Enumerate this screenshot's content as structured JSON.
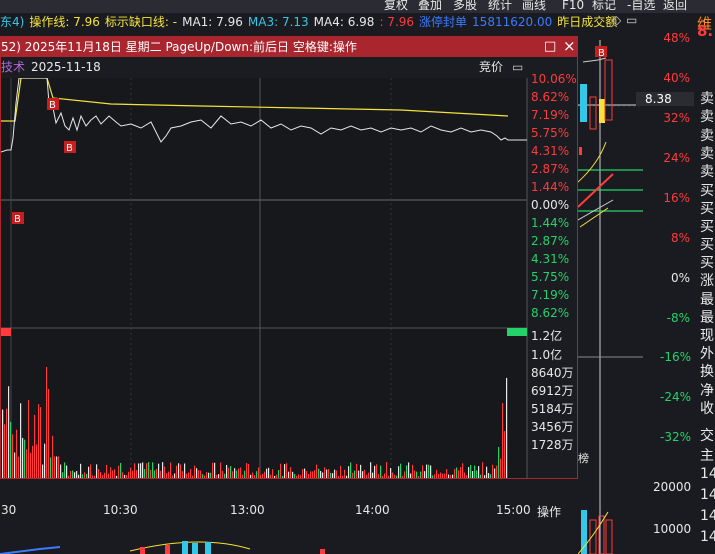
{
  "toolbar": {
    "buttons": [
      "复权",
      "叠加",
      "多股",
      "统计",
      "画线",
      "F10",
      "标记",
      "-自选",
      "返回"
    ],
    "accent_label": "维",
    "price_fragment": "8."
  },
  "indicator_line": {
    "prefix": "东4)",
    "op_line": "操作线: 7.96",
    "gap_line": "标示缺口线: -",
    "ma1": "MA1: 7.96",
    "ma3": "MA3: 7.13",
    "ma4": "MA4: 6.98",
    "ma_last": ": 7.96",
    "limit_label": "涨停封单",
    "limit_value": "15811620.00",
    "prev_amount": "昨日成交额"
  },
  "popup": {
    "title": "52) 2025年11月18日 星期二 PageUp/Down:前后日 空格键:操作",
    "max_icon": "□",
    "close_icon": "×",
    "subtitle_left": "技术",
    "date": "2025-11-18",
    "auction": "竞价",
    "auction_icon": "▭",
    "pct_labels": [
      "10.06%",
      "8.62%",
      "7.19%",
      "5.75%",
      "4.31%",
      "2.87%",
      "1.44%",
      "0.00%",
      "1.44%",
      "2.87%",
      "4.31%",
      "5.75%",
      "7.19%",
      "8.62%"
    ],
    "vol_labels": [
      "1.2亿",
      "1.0亿",
      "8640万",
      "6912万",
      "5184万",
      "3456万",
      "1728万"
    ],
    "time_labels": [
      "30",
      "10:30",
      "13:00",
      "14:00",
      "15:00"
    ],
    "operate_label": "操作",
    "b_marker": "B"
  },
  "right_panel": {
    "pct_labels": [
      "48%",
      "40%",
      "32%",
      "24%",
      "16%",
      "8%",
      "0%",
      "-8%",
      "-16%",
      "-24%",
      "-32%"
    ],
    "price_tag": "8.38",
    "side_chars": [
      "卖",
      "卖",
      "卖",
      "卖",
      "卖",
      "买",
      "买",
      "买",
      "买",
      "买",
      "涨",
      "最",
      "最",
      "现",
      "外",
      "换",
      "净",
      "收",
      "交",
      "主",
      "14",
      "14",
      "14",
      "14"
    ],
    "vol_labels": [
      "20000",
      "10000"
    ],
    "b_marker": "B",
    "bang_label": "榜"
  },
  "colors": {
    "up": "#ff3b3b",
    "down": "#23d36a",
    "yellow": "#f5e33a",
    "cyan": "#35c7e8",
    "title_bar": "#a9262f"
  }
}
